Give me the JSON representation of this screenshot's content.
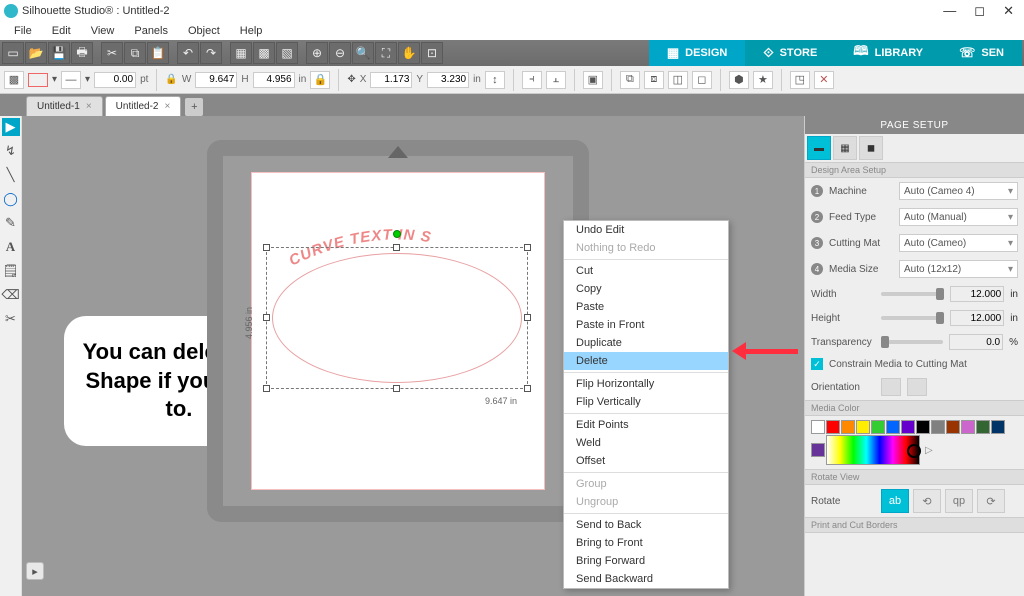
{
  "window": {
    "title": "Silhouette Studio® : Untitled-2"
  },
  "menu": [
    "File",
    "Edit",
    "View",
    "Panels",
    "Object",
    "Help"
  ],
  "topTabs": {
    "design": "DESIGN",
    "store": "STORE",
    "library": "LIBRARY",
    "send": "SEN"
  },
  "propbar": {
    "stroke_w": "0.00",
    "stroke_u": "pt",
    "w_lbl": "W",
    "w": "9.647",
    "h_lbl": "H",
    "h": "4.956",
    "size_u": "in",
    "x_lbl": "X",
    "x": "1.173",
    "y_lbl": "Y",
    "y": "3.230",
    "pos_u": "in"
  },
  "tabs": {
    "t1": "Untitled-1",
    "t2": "Untitled-2"
  },
  "canvas": {
    "curved_text": "CURVE TEXT IN S",
    "dim_w": "9.647 in",
    "dim_h": "4.956 in"
  },
  "callout": "You can delete the Shape if you want to.",
  "ctx": {
    "undo": "Undo Edit",
    "redo": "Nothing to Redo",
    "cut": "Cut",
    "copy": "Copy",
    "paste": "Paste",
    "pastefront": "Paste in Front",
    "dup": "Duplicate",
    "del": "Delete",
    "fliph": "Flip Horizontally",
    "flipv": "Flip Vertically",
    "editpts": "Edit Points",
    "weld": "Weld",
    "offset": "Offset",
    "group": "Group",
    "ungroup": "Ungroup",
    "sendback": "Send to Back",
    "bringfront": "Bring to Front",
    "bringfwd": "Bring Forward",
    "sendbkwd": "Send Backward"
  },
  "panel": {
    "title": "PAGE SETUP",
    "section_area": "Design Area Setup",
    "machine_lbl": "Machine",
    "machine_val": "Auto (Cameo 4)",
    "feed_lbl": "Feed Type",
    "feed_val": "Auto (Manual)",
    "mat_lbl": "Cutting Mat",
    "mat_val": "Auto (Cameo)",
    "media_lbl": "Media Size",
    "media_val": "Auto (12x12)",
    "width_lbl": "Width",
    "width_val": "12.000",
    "unit_in": "in",
    "height_lbl": "Height",
    "height_val": "12.000",
    "trans_lbl": "Transparency",
    "trans_val": "0.0",
    "unit_pct": "%",
    "constrain": "Constrain Media to Cutting Mat",
    "orient_lbl": "Orientation",
    "section_color": "Media Color",
    "section_rotate": "Rotate View",
    "rotate_lbl": "Rotate",
    "section_print": "Print and Cut Borders"
  },
  "swatches": [
    "#ffffff",
    "#ff0000",
    "#ff8800",
    "#ffee00",
    "#33cc33",
    "#0066ff",
    "#6600cc",
    "#000000",
    "#808080",
    "#993300",
    "#cc66cc",
    "#336633",
    "#003366",
    "#663399"
  ]
}
